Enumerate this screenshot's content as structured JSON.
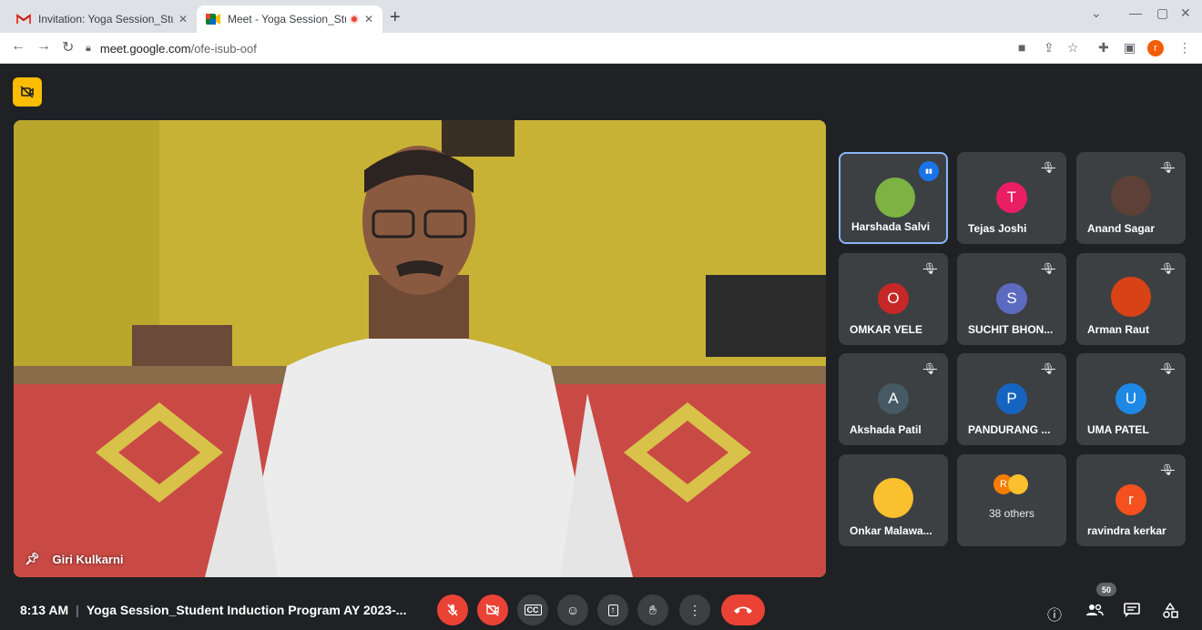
{
  "browser": {
    "tabs": [
      {
        "title": "Invitation: Yoga Session_Student",
        "favicon": "gmail-icon",
        "active": false
      },
      {
        "title": "Meet - Yoga Session_Student",
        "favicon": "meet-icon",
        "active": true
      }
    ],
    "url_host": "meet.google.com",
    "url_path": "/ofe-isub-oof",
    "profile_initial": "r"
  },
  "meet": {
    "main_speaker": "Giri Kulkarni",
    "participants": [
      {
        "name": "Harshada Salvi",
        "initial": "",
        "avatar_color": "#7cb342",
        "photo": true,
        "speaking": true,
        "muted": false
      },
      {
        "name": "Tejas Joshi",
        "initial": "T",
        "avatar_color": "#e91e63",
        "photo": false,
        "speaking": false,
        "muted": true
      },
      {
        "name": "Anand Sagar",
        "initial": "",
        "avatar_color": "#5d4037",
        "photo": true,
        "speaking": false,
        "muted": true
      },
      {
        "name": "OMKAR VELE",
        "initial": "O",
        "avatar_color": "#c62828",
        "photo": false,
        "speaking": false,
        "muted": true
      },
      {
        "name": "SUCHIT BHON...",
        "initial": "S",
        "avatar_color": "#5c6bc0",
        "photo": false,
        "speaking": false,
        "muted": true
      },
      {
        "name": "Arman Raut",
        "initial": "",
        "avatar_color": "#d84315",
        "photo": true,
        "speaking": false,
        "muted": true
      },
      {
        "name": "Akshada Patil",
        "initial": "A",
        "avatar_color": "#455a64",
        "photo": false,
        "speaking": false,
        "muted": true
      },
      {
        "name": "PANDURANG ...",
        "initial": "P",
        "avatar_color": "#1565c0",
        "photo": false,
        "speaking": false,
        "muted": true
      },
      {
        "name": "UMA PATEL",
        "initial": "U",
        "avatar_color": "#1e88e5",
        "photo": false,
        "speaking": false,
        "muted": true
      },
      {
        "name": "Onkar Malawa...",
        "initial": "",
        "avatar_color": "#fbc02d",
        "photo": true,
        "speaking": false,
        "muted": false
      },
      {
        "name": "",
        "initial": "R",
        "avatar_color": "#f57c00",
        "photo": false,
        "speaking": false,
        "muted": false,
        "others_label": "38 others"
      },
      {
        "name": "ravindra kerkar",
        "initial": "r",
        "avatar_color": "#f4511e",
        "photo": false,
        "speaking": false,
        "muted": true
      }
    ],
    "time": "8:13 AM",
    "meeting_title": "Yoga Session_Student Induction Program AY 2023-...",
    "participant_count": "50"
  }
}
